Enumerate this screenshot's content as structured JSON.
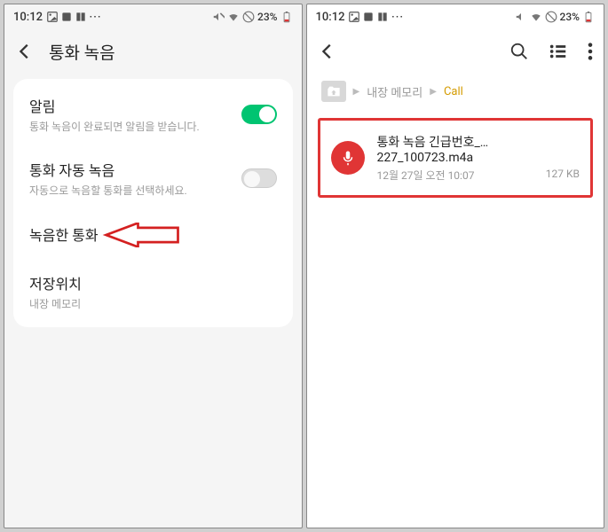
{
  "status": {
    "time": "10:12",
    "battery_text": "23%"
  },
  "left": {
    "header_title": "통화 녹음",
    "settings": {
      "notify": {
        "title": "알림",
        "sub": "통화 녹음이 완료되면 알림을 받습니다."
      },
      "auto": {
        "title": "통화 자동 녹음",
        "sub": "자동으로 녹음할 통화를 선택하세요."
      },
      "recorded": {
        "title": "녹음한 통화"
      },
      "location": {
        "title": "저장위치",
        "sub": "내장 메모리"
      }
    }
  },
  "right": {
    "breadcrumb": {
      "root": "내장 메모리",
      "current": "Call"
    },
    "file": {
      "name": "통화 녹음 긴급번호_…227_100723.m4a",
      "date": "12월 27일 오전 10:07",
      "size": "127 KB"
    }
  }
}
